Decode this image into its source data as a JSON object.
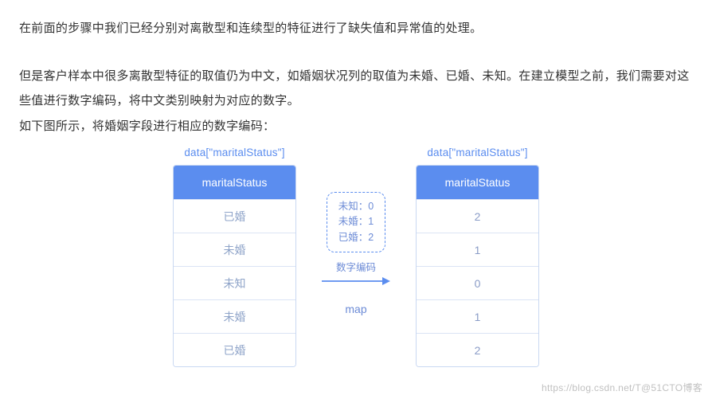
{
  "paragraphs": {
    "p1": "在前面的步骤中我们已经分别对离散型和连续型的特征进行了缺失值和异常值的处理。",
    "p2": "但是客户样本中很多离散型特征的取值仍为中文，如婚姻状况列的取值为未婚、已婚、未知。在建立模型之前，我们需要对这些值进行数字编码，将中文类别映射为对应的数字。",
    "p3": "如下图所示，将婚姻字段进行相应的数字编码："
  },
  "diagram": {
    "leftLabel": "data[\"maritalStatus\"]",
    "rightLabel": "data[\"maritalStatus\"]",
    "header": "maritalStatus",
    "leftValues": [
      "已婚",
      "未婚",
      "未知",
      "未婚",
      "已婚"
    ],
    "rightValues": [
      "2",
      "1",
      "0",
      "1",
      "2"
    ],
    "mapping": {
      "rows": [
        "未知：0",
        "未婚：1",
        "已婚：2"
      ]
    },
    "arrowLabel": "数字编码",
    "mapLabel": "map"
  },
  "watermark": "https://blog.csdn.net/T@51CTO博客"
}
